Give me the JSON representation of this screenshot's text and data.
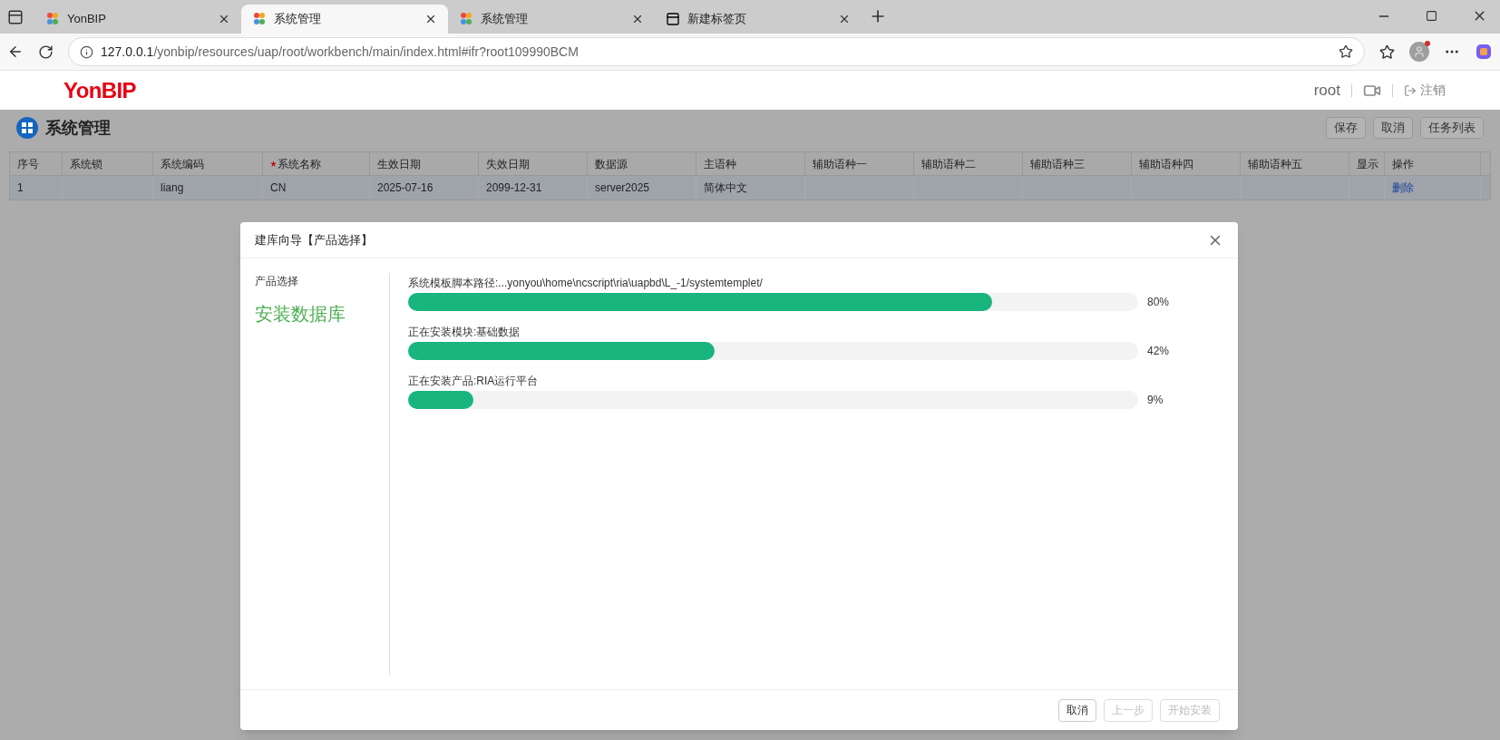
{
  "browser": {
    "tabs": [
      {
        "title": "YonBIP",
        "selected": false,
        "kind": "app"
      },
      {
        "title": "系统管理",
        "selected": true,
        "kind": "app"
      },
      {
        "title": "系统管理",
        "selected": false,
        "kind": "app"
      },
      {
        "title": "新建标签页",
        "selected": false,
        "kind": "newtab"
      }
    ],
    "url": {
      "host": "127.0.0.1",
      "path": "/yonbip/resources/uap/root/workbench/main/index.html#ifr?root109990BCM"
    }
  },
  "header": {
    "logo": "YonBIP",
    "user": "root",
    "logout": "注销"
  },
  "page": {
    "title": "系统管理",
    "buttons": [
      "保存",
      "取消",
      "任务列表"
    ]
  },
  "table": {
    "columns": [
      {
        "label": "序号",
        "required": false
      },
      {
        "label": "系统锁",
        "required": false
      },
      {
        "label": "系统编码",
        "required": false
      },
      {
        "label": "系统名称",
        "required": true
      },
      {
        "label": "生效日期",
        "required": false
      },
      {
        "label": "失效日期",
        "required": false
      },
      {
        "label": "数据源",
        "required": false
      },
      {
        "label": "主语种",
        "required": false
      },
      {
        "label": "辅助语种一",
        "required": false
      },
      {
        "label": "辅助语种二",
        "required": false
      },
      {
        "label": "辅助语种三",
        "required": false
      },
      {
        "label": "辅助语种四",
        "required": false
      },
      {
        "label": "辅助语种五",
        "required": false
      },
      {
        "label": "显示",
        "required": false
      },
      {
        "label": "操作",
        "required": false
      }
    ],
    "rows": [
      {
        "cells": [
          "1",
          "",
          "liang",
          "CN",
          "2025-07-16",
          "2099-12-31",
          "server2025",
          "简体中文",
          "",
          "",
          "",
          "",
          "",
          "",
          ""
        ],
        "action": "删除"
      }
    ]
  },
  "dialog": {
    "title": "建库向导【产品选择】",
    "steps": [
      {
        "label": "产品选择",
        "selected": false
      },
      {
        "label": "安装数据库",
        "selected": true
      }
    ],
    "progress": [
      {
        "label": "系统模板脚本路径:...yonyou\\home\\ncscript\\ria\\uapbd\\L_-1/systemtemplet/",
        "level": 0.8,
        "reading": "80%"
      },
      {
        "label": "正在安装模块:基础数据",
        "level": 0.42,
        "reading": "42%"
      },
      {
        "label": "正在安装产品:RIA运行平台",
        "level": 0.09,
        "reading": "9%"
      }
    ],
    "buttons": [
      {
        "label": "取消",
        "disabled": false
      },
      {
        "label": "上一步",
        "disabled": true
      },
      {
        "label": "开始安装",
        "disabled": true
      }
    ]
  }
}
